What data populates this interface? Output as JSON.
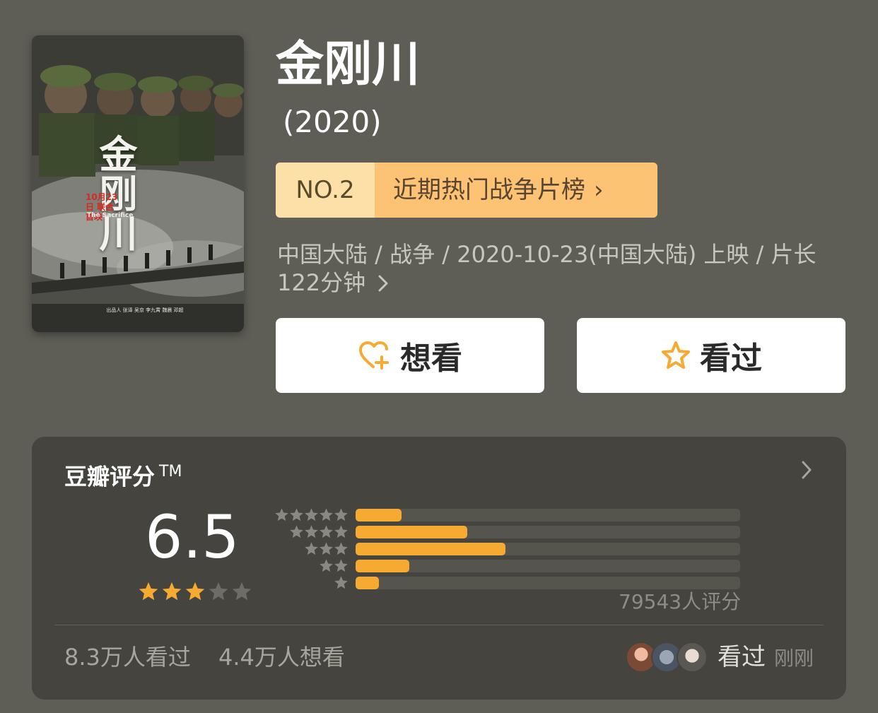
{
  "poster": {
    "title_art": "金刚川",
    "release_tag": "10月23日 联合首映",
    "english_title": "The Sacrifice",
    "credits": "出品人 张译 吴京 李九霄 魏晨 邓超"
  },
  "movie": {
    "title": "金刚川",
    "year": "(2020)",
    "meta": "中国大陆 / 战争 / 2020-10-23(中国大陆) 上映 / 片长 122分钟"
  },
  "rank": {
    "number": "NO.2",
    "list_name": "近期热门战争片榜",
    "chevron": "›"
  },
  "actions": {
    "want_label": "想看",
    "seen_label": "看过",
    "want_icon": "heart-plus-icon",
    "seen_icon": "star-outline-icon",
    "icon_color": "#f6aa31"
  },
  "rating": {
    "title": "豆瓣评分",
    "trademark": "TM",
    "score": "6.5",
    "stars_filled": 3,
    "stars_total": 5,
    "distribution": [
      {
        "stars": 5,
        "fraction": 0.12
      },
      {
        "stars": 4,
        "fraction": 0.29
      },
      {
        "stars": 3,
        "fraction": 0.39
      },
      {
        "stars": 2,
        "fraction": 0.14
      },
      {
        "stars": 1,
        "fraction": 0.06
      }
    ],
    "count_text": "79543人评分",
    "bar_color": "#f6aa31",
    "star_color": "#f6aa31"
  },
  "stats": {
    "seen_text": "8.3万人看过",
    "want_text": "4.4万人想看"
  },
  "friends": {
    "action": "看过",
    "time": "刚刚"
  }
}
